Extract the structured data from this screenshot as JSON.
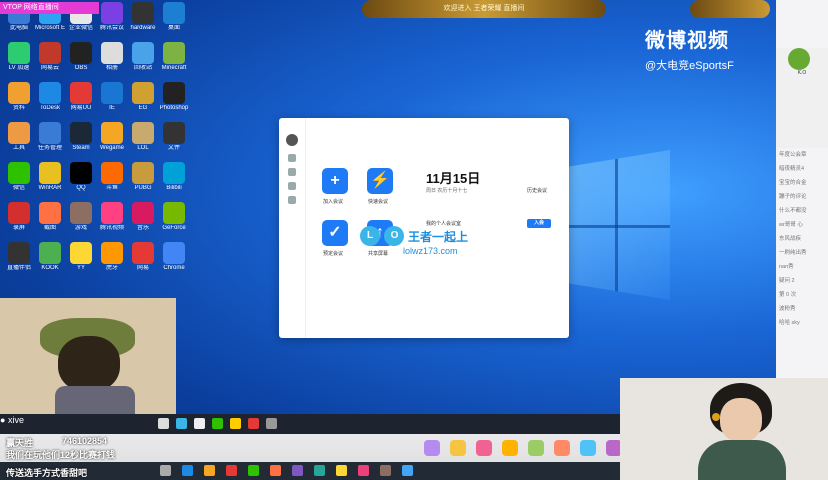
{
  "overlay": {
    "room_tag": "VTOP 网络直播间",
    "top_banner": "欢迎进入 王者荣耀 直播间",
    "weibo_title": "微博视频",
    "weibo_handle": "@大电竞eSportsF",
    "watermark_brand": "王者一起上",
    "watermark_url": "lolwz173.com"
  },
  "zoom": {
    "date": "11月15日",
    "subdate": "周日 农历十月十七",
    "btn_join_label": "加入会议",
    "btn_quick_label": "快速会议",
    "btn_schedule_label": "预定会议",
    "btn_share_label": "共享屏幕",
    "meeting_title": "我的个人会议室",
    "join_btn": "入会",
    "history_label": "历史会议"
  },
  "danmu": {
    "user": "xive",
    "line1": "赢天胜",
    "qq": "746102854",
    "line2": "我们在玩他们12秒比赛打钱",
    "line3": "传送选手方式香甜吧"
  },
  "chat": {
    "ko": "K.O",
    "rows": [
      "年度公会章",
      "暗夜精灵4",
      "宝宝的合金",
      "蹦子的评论",
      "什么不都没",
      "wr哥哥 心",
      "东风战疾",
      "一刷纯出秀",
      "nan秀",
      "疑问 2",
      "第 0 次",
      "波粉秀",
      "哈哈 sky"
    ]
  },
  "colors": {
    "zoom_blue": "#1e7bf5",
    "desktop_blue": "#1a66d6",
    "room_tag": "#e53bd5"
  },
  "desktop_icons": [
    {
      "name": "此电脑",
      "color": "#3a7bd5"
    },
    {
      "name": "Microsoft Edge",
      "color": "#2ea3f2"
    },
    {
      "name": "企业微信",
      "color": "#e8e8e8"
    },
    {
      "name": "腾讯会议",
      "color": "#7b3fe4"
    },
    {
      "name": "hardware",
      "color": "#333"
    },
    {
      "name": "桌面",
      "color": "#1d7fd1"
    },
    {
      "name": "LV 加速",
      "color": "#2ecc71"
    },
    {
      "name": "网易云",
      "color": "#c0392b"
    },
    {
      "name": "OBS",
      "color": "#222"
    },
    {
      "name": "相册",
      "color": "#ddd"
    },
    {
      "name": "回收站",
      "color": "#4aa3e8"
    },
    {
      "name": "Minecraft",
      "color": "#7cb342"
    },
    {
      "name": "资料",
      "color": "#f0a030"
    },
    {
      "name": "ToDesk",
      "color": "#1e88e5"
    },
    {
      "name": "网易UU",
      "color": "#e53935"
    },
    {
      "name": "IE",
      "color": "#1976d2"
    },
    {
      "name": "EG",
      "color": "#d0a030"
    },
    {
      "name": "Photoshop",
      "color": "#222"
    },
    {
      "name": "工具",
      "color": "#e94"
    },
    {
      "name": "任务管理",
      "color": "#3a7bd5"
    },
    {
      "name": "Steam",
      "color": "#1b2838"
    },
    {
      "name": "Wegame",
      "color": "#f5a623"
    },
    {
      "name": "LOL",
      "color": "#c8aa6e"
    },
    {
      "name": "文件",
      "color": "#333"
    },
    {
      "name": "微信",
      "color": "#2dc100"
    },
    {
      "name": "WinRAR",
      "color": "#e8c020"
    },
    {
      "name": "QQ",
      "color": "#000"
    },
    {
      "name": "斗鱼",
      "color": "#ff6a00"
    },
    {
      "name": "PUBG",
      "color": "#c89b3c"
    },
    {
      "name": "Bilibili",
      "color": "#00a1d6"
    },
    {
      "name": "录屏",
      "color": "#d32f2f"
    },
    {
      "name": "截图",
      "color": "#ff7043"
    },
    {
      "name": "游戏",
      "color": "#8d6e63"
    },
    {
      "name": "腾讯视频",
      "color": "#ff4081"
    },
    {
      "name": "音乐",
      "color": "#d81b60"
    },
    {
      "name": "GeForce",
      "color": "#76b900"
    },
    {
      "name": "直播伴侣",
      "color": "#333"
    },
    {
      "name": "KOOK",
      "color": "#4caf50"
    },
    {
      "name": "YY",
      "color": "#fdd835"
    },
    {
      "name": "虎牙",
      "color": "#ff9800"
    },
    {
      "name": "网易",
      "color": "#e53935"
    },
    {
      "name": "Chrome",
      "color": "#4285f4"
    }
  ]
}
